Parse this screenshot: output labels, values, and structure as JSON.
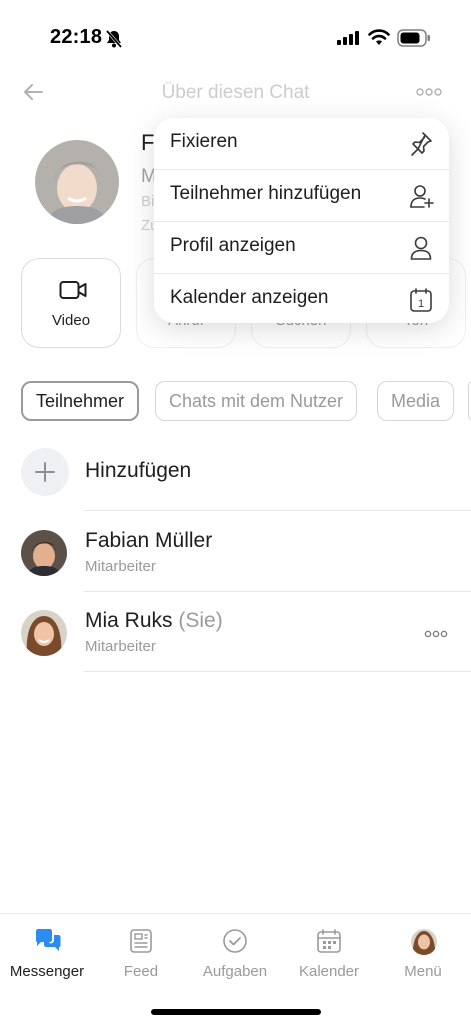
{
  "status": {
    "time": "22:18"
  },
  "header": {
    "title": "Über diesen Chat"
  },
  "profile": {
    "name_visible": "F",
    "line2_visible": "M",
    "line3_visible": "Bi",
    "line4_visible": "Zu"
  },
  "actions": [
    {
      "label": "Video",
      "icon": "video-icon"
    },
    {
      "label": "Anruf",
      "icon": "phone-icon"
    },
    {
      "label": "Suchen",
      "icon": "search-icon"
    },
    {
      "label": "Ton",
      "icon": "sound-icon"
    }
  ],
  "chips": [
    "Teilnehmer",
    "Chats mit dem Nutzer",
    "Media"
  ],
  "add_row": {
    "label": "Hinzufügen"
  },
  "members": [
    {
      "name": "Fabian Müller",
      "suffix": "",
      "role": "Mitarbeiter"
    },
    {
      "name": "Mia Ruks",
      "suffix": "(Sie)",
      "role": "Mitarbeiter"
    }
  ],
  "popup_menu": {
    "items": [
      {
        "label": "Fixieren",
        "icon": "pin-icon"
      },
      {
        "label": "Teilnehmer hinzufügen",
        "icon": "add-user-icon"
      },
      {
        "label": "Profil anzeigen",
        "icon": "user-icon"
      },
      {
        "label": "Kalender anzeigen",
        "icon": "calendar-icon",
        "icon_text": "1"
      }
    ]
  },
  "tabbar": {
    "tabs": [
      {
        "label": "Messenger",
        "icon": "messenger-icon",
        "active": true
      },
      {
        "label": "Feed",
        "icon": "feed-icon",
        "active": false
      },
      {
        "label": "Aufgaben",
        "icon": "tasks-icon",
        "active": false
      },
      {
        "label": "Kalender",
        "icon": "calendar-tab-icon",
        "active": false
      },
      {
        "label": "Menü",
        "icon": "avatar-menu-icon",
        "active": false
      }
    ]
  },
  "colors": {
    "accent": "#2d8cf0",
    "muted": "#9a9a9a",
    "text": "#1e1e1e"
  }
}
